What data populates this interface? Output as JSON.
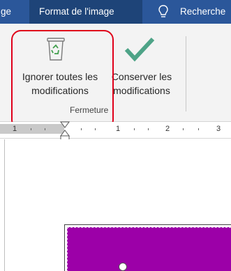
{
  "tabs": {
    "previous_tab": "ge",
    "active_tab": "Format de l'image",
    "tell_me": "Recherche"
  },
  "ribbon": {
    "discard_label": "Ignorer toutes les modifications",
    "keep_label": "Conserver les modifications",
    "group_label": "Fermeture"
  },
  "ruler": {
    "marks": [
      "1",
      "1",
      "2",
      "3"
    ]
  },
  "colors": {
    "tab_background": "#2b579a",
    "active_tab": "#1e4478",
    "check_green": "#4ea387",
    "highlight_red": "#e0001a",
    "image_fill": "#9c00a8"
  }
}
